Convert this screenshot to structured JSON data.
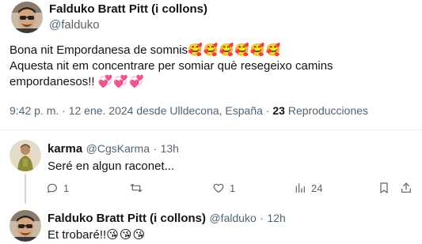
{
  "main_tweet": {
    "display_name": "Falduko Bratt Pitt (i collons)",
    "handle": "@falduko",
    "line1": "Bona nit Empordanesa de somnis",
    "line1_emoji": "🥰🥰🥰🥰🥰🥰",
    "line2": "Aquesta nit em concentrare per somiar què resegeixo camins",
    "line3": "empordanesos!!",
    "line3_emoji": "💞💞💞",
    "time": "9:42 p. m.",
    "date": "12 ene. 2024",
    "location": "desde Ulldecona, España",
    "separator": "·",
    "views_count": "23",
    "views_label": "Reproducciones"
  },
  "reply_1": {
    "display_name": "karma",
    "handle": "@CgsKarma",
    "age": "13h",
    "separator": "·",
    "text": "Seré en algun raconet...",
    "actions": {
      "replies": "1",
      "retweets": "",
      "likes": "1",
      "views": "24"
    }
  },
  "reply_2": {
    "display_name": "Falduko Bratt Pitt (i collons)",
    "handle": "@falduko",
    "age": "12h",
    "separator": "·",
    "text": "Et trobaré!!",
    "emoji": "😘😘😘"
  },
  "icons": [
    "reply-icon",
    "retweet-icon",
    "like-icon",
    "views-icon",
    "bookmark-icon",
    "share-icon"
  ],
  "colors": {
    "text": "#0f1419",
    "muted": "#536471",
    "divider": "#eff3f4",
    "thread_line": "#cfd9de"
  }
}
